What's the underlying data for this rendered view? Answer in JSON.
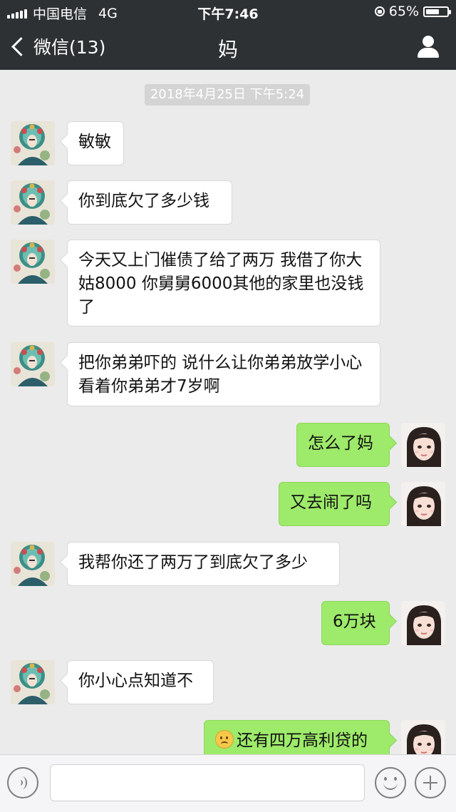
{
  "status_bar": {
    "carrier": "中国电信",
    "network": "4G",
    "time": "下午7:46",
    "battery": "65%",
    "battery_level": 0.65
  },
  "nav": {
    "back_label": "微信(13)",
    "title": "妈"
  },
  "chat": {
    "timestamp": "2018年4月25日 下午5:24",
    "messages": [
      {
        "side": "left",
        "text": "敏敏"
      },
      {
        "side": "left",
        "text": "你到底欠了多少钱"
      },
      {
        "side": "left",
        "text": "今天又上门催债了给了两万 我借了你大姑8000 你舅舅6000其他的家里也没钱了"
      },
      {
        "side": "left",
        "text": "把你弟弟吓的 说什么让你弟弟放学小心看着你弟弟才7岁啊"
      },
      {
        "side": "right",
        "text": "怎么了妈"
      },
      {
        "side": "right",
        "text": "又去闹了吗"
      },
      {
        "side": "left",
        "text": "我帮你还了两万了到底欠了多少"
      },
      {
        "side": "right",
        "text": "6万块"
      },
      {
        "side": "left",
        "text": "你小心点知道不"
      },
      {
        "side": "right",
        "text": "还有四万高利贷的",
        "emoji": "frown-emoji"
      }
    ]
  },
  "input_bar": {
    "text_value": "",
    "icons": [
      "voice-icon",
      "emoji-icon",
      "plus-icon"
    ]
  },
  "colors": {
    "header_bg": "#2e3133",
    "chat_bg": "#ebebeb",
    "sent_bubble": "#9eea6a",
    "received_bubble": "#ffffff"
  }
}
